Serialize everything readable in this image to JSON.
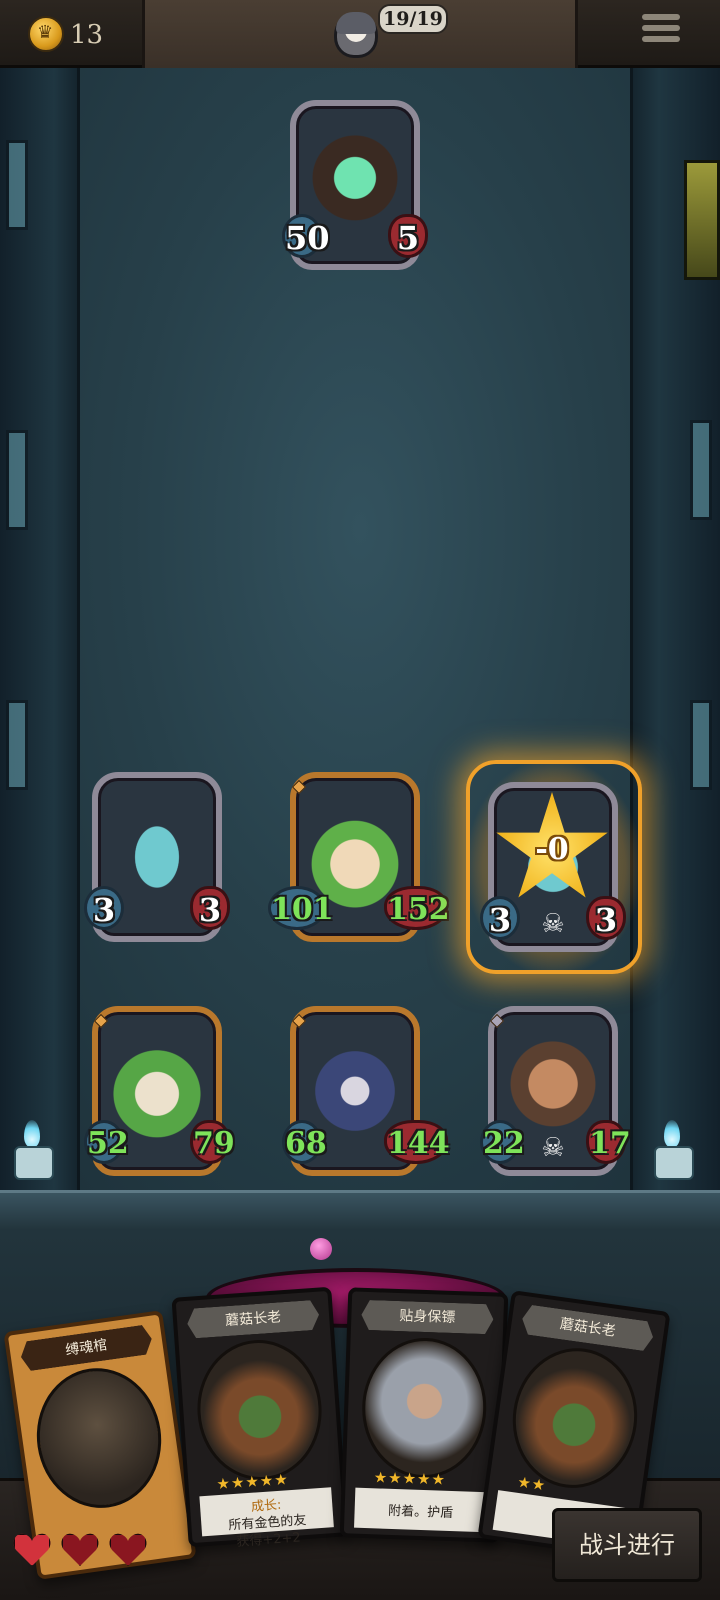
{
  "topbar": {
    "coins": "13",
    "turns": "19/19"
  },
  "enemy": {
    "attack": "50",
    "health": "5"
  },
  "board": {
    "row1": [
      {
        "attack": "3",
        "health": "3"
      },
      {
        "attack": "101",
        "health": "152"
      },
      {
        "attack": "3",
        "health": "3",
        "effect": "-0"
      }
    ],
    "row2": [
      {
        "attack": "52",
        "health": "79"
      },
      {
        "attack": "68",
        "health": "144"
      },
      {
        "attack": "22",
        "health": "17"
      }
    ]
  },
  "hand": [
    {
      "title": "缚魂棺"
    },
    {
      "title": "蘑菇长老",
      "stars": "★★★★★",
      "desc_1": "成长:",
      "desc_2": "所有金色的友",
      "desc_3": "获得+2+2"
    },
    {
      "title": "贴身保镖",
      "stars": "★★★★★",
      "desc_1": "附着。护盾"
    },
    {
      "title": "蘑菇长老",
      "stars": "★★",
      "desc_1": "所"
    }
  ],
  "hearts": {
    "filled": 1,
    "total": 3
  },
  "actions": {
    "fight_label": "战斗进行"
  }
}
